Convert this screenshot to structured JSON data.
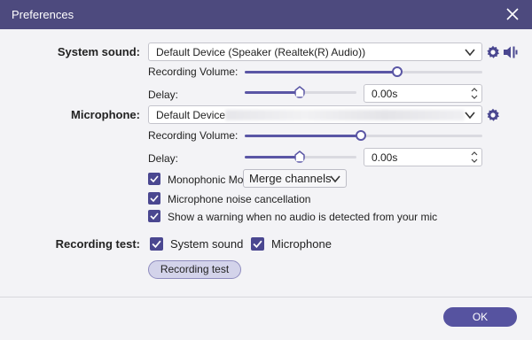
{
  "window": {
    "title": "Preferences"
  },
  "system_sound": {
    "label": "System sound:",
    "device": "Default Device (Speaker (Realtek(R) Audio))",
    "volume_label": "Recording Volume:",
    "volume_level": 0.64,
    "delay_label": "Delay:",
    "delay_level": 0.49,
    "delay_value": "0.00s"
  },
  "microphone": {
    "label": "Microphone:",
    "device": "Default Device",
    "volume_label": "Recording Volume:",
    "volume_level": 0.49,
    "delay_label": "Delay:",
    "delay_level": 0.49,
    "delay_value": "0.00s"
  },
  "options": {
    "mono_label": "Monophonic Mode",
    "mono_select": "Merge channels",
    "noise_label": "Microphone noise cancellation",
    "warning_label": "Show a warning when no audio is detected from your mic"
  },
  "recording_test": {
    "label": "Recording test:",
    "system_sound": "System sound",
    "microphone": "Microphone",
    "button": "Recording test"
  },
  "footer": {
    "ok": "OK"
  },
  "colors": {
    "accent": "#5a56a5",
    "title_bar": "#4d4a7e",
    "background": "#f3f3f6"
  },
  "icons": [
    "close-icon",
    "gear-icon",
    "speaker-icon",
    "chevron-down-icon",
    "spin-arrows-icon",
    "checkmark-icon"
  ]
}
